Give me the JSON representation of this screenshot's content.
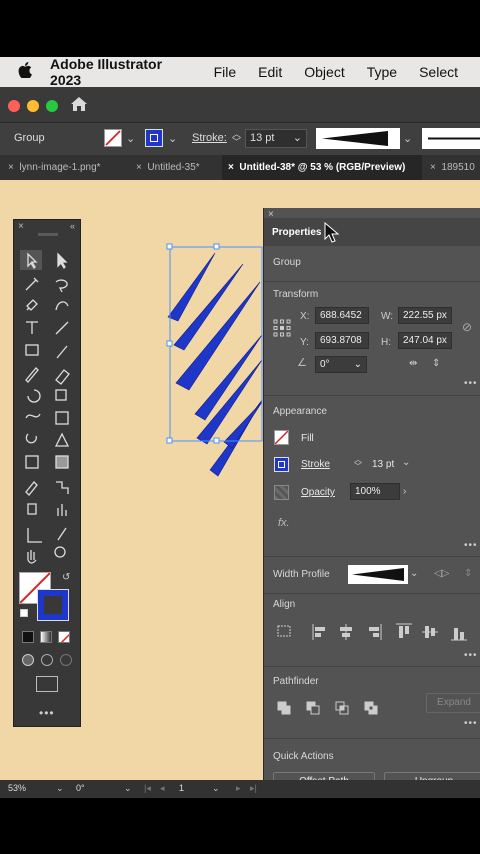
{
  "menubar": {
    "app_name": "Adobe Illustrator 2023",
    "items": [
      "File",
      "Edit",
      "Object",
      "Type",
      "Select"
    ]
  },
  "colors": {
    "canvas": "#f2d7a6",
    "spike_fill": "#1f37c9",
    "selection": "#4a90ff",
    "panel": "#535353",
    "traffic_red": "#fe5f57",
    "traffic_yellow": "#febc2e",
    "traffic_green": "#28c840"
  },
  "controlbar": {
    "selection_type": "Group",
    "stroke_label": "Stroke:",
    "stroke_weight": "13 pt"
  },
  "tabs": [
    {
      "label": "lynn-image-1.png*",
      "active": false
    },
    {
      "label": "Untitled-35*",
      "active": false
    },
    {
      "label": "Untitled-38* @ 53 % (RGB/Preview)",
      "active": true
    },
    {
      "label": "189510",
      "active": false
    }
  ],
  "properties": {
    "title": "Properties",
    "selection_type": "Group",
    "transform": {
      "header": "Transform",
      "x_label": "X:",
      "x": "688.6452",
      "y_label": "Y:",
      "y": "693.8708",
      "w_label": "W:",
      "w": "222.55 px",
      "h_label": "H:",
      "h": "247.04 px",
      "angle": "0°"
    },
    "appearance": {
      "header": "Appearance",
      "fill_label": "Fill",
      "stroke_label": "Stroke",
      "stroke_weight": "13 pt",
      "opacity_label": "Opacity",
      "opacity": "100%",
      "fx_label": "fx."
    },
    "width_profile_label": "Width Profile",
    "align_header": "Align",
    "pathfinder": {
      "header": "Pathfinder",
      "expand_label": "Expand"
    },
    "quick_actions": {
      "header": "Quick Actions",
      "offset_path_label": "Offset Path",
      "ungroup_label": "Ungroup"
    }
  },
  "statusbar": {
    "zoom": "53%",
    "rotation": "0°",
    "artboard": "1"
  }
}
